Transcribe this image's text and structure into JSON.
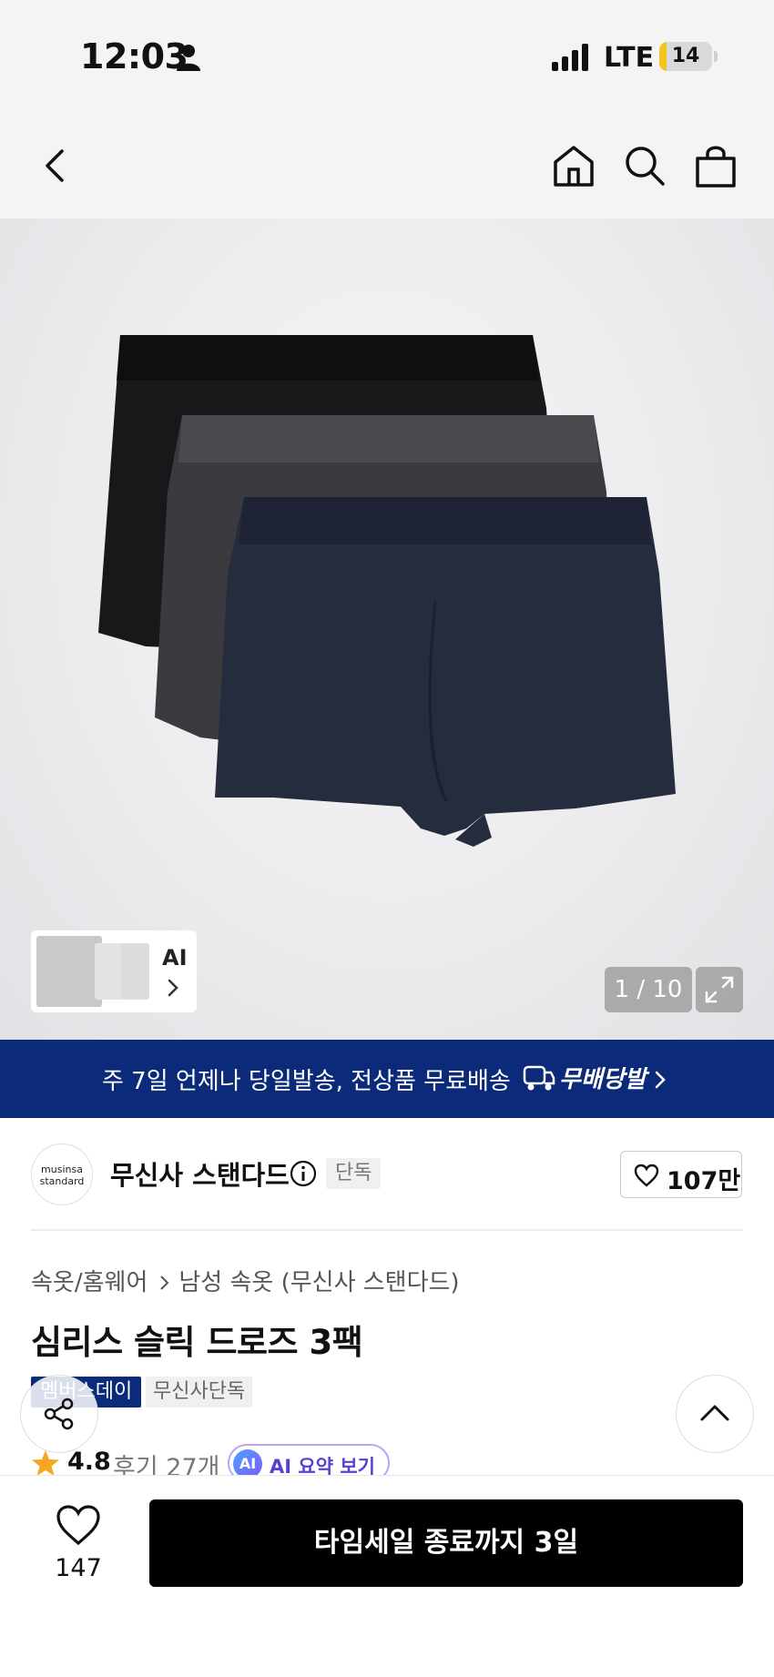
{
  "status_bar": {
    "time": "12:03",
    "network": "LTE",
    "battery": "14",
    "battery_level": 0.14
  },
  "nav": {
    "icons": [
      "back-icon",
      "home-icon",
      "search-icon",
      "shopping-bag-icon"
    ]
  },
  "gallery": {
    "ai_label": "AI",
    "pager": "1 / 10"
  },
  "banner": {
    "text": "주 7일 언제나 당일발송, 전상품 무료배송",
    "brand": "무배당발"
  },
  "brand": {
    "logo_line1": "musinsa",
    "logo_line2": "standard",
    "name": "무신사 스탠다드",
    "tag": "단독",
    "likes": "107만"
  },
  "product": {
    "breadcrumb": [
      "속옷/홈웨어",
      "남성 속옷 (무신사 스탠다드)"
    ],
    "title": "심리스 슬릭 드로즈 3팩",
    "badges": [
      "멤버스데이",
      "무신사단독"
    ],
    "rating": "4.8",
    "reviews": "후기 27개",
    "ai_badge": "AI",
    "ai_summary": "AI 요약 보기"
  },
  "bottom_bar": {
    "wishlist_count": "147",
    "cta": "타임세일 종료까지 3일"
  },
  "colors": {
    "banner": "#0b2a7a",
    "cta": "#000000",
    "ai_accent": "#7b5cff",
    "star": "#f5a623"
  }
}
